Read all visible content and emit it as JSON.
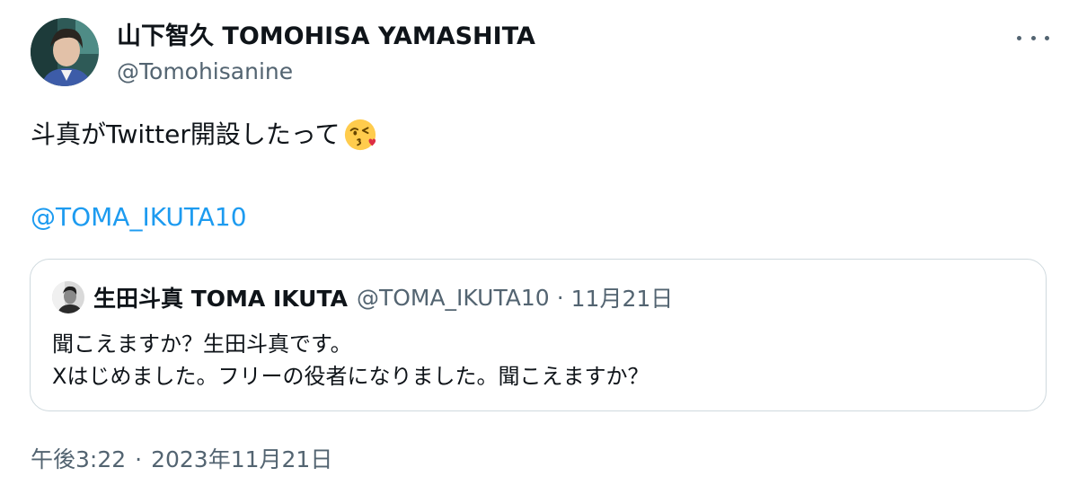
{
  "author": {
    "display_name": "山下智久 TOMOHISA YAMASHITA",
    "handle": "@Tomohisanine",
    "avatar_icon": "user-avatar-photo"
  },
  "more_icon": "more-horizontal-icon",
  "tweet": {
    "text": "斗真がTwitter開設したって",
    "emoji": "face-blowing-kiss-emoji",
    "mention": "@TOMA_IKUTA10"
  },
  "quote": {
    "display_name": "生田斗真 TOMA IKUTA",
    "handle": "@TOMA_IKUTA10",
    "separator": "·",
    "date": "11月21日",
    "line1": "聞こえますか？生田斗真です。",
    "line2": "Xはじめました。フリーの役者になりました。聞こえますか？"
  },
  "meta": {
    "time": "午後3:22",
    "separator": "·",
    "date": "2023年11月21日"
  },
  "colors": {
    "text": "#0f1419",
    "secondary": "#536471",
    "link": "#1d9bf0",
    "border": "#cfd9de"
  }
}
